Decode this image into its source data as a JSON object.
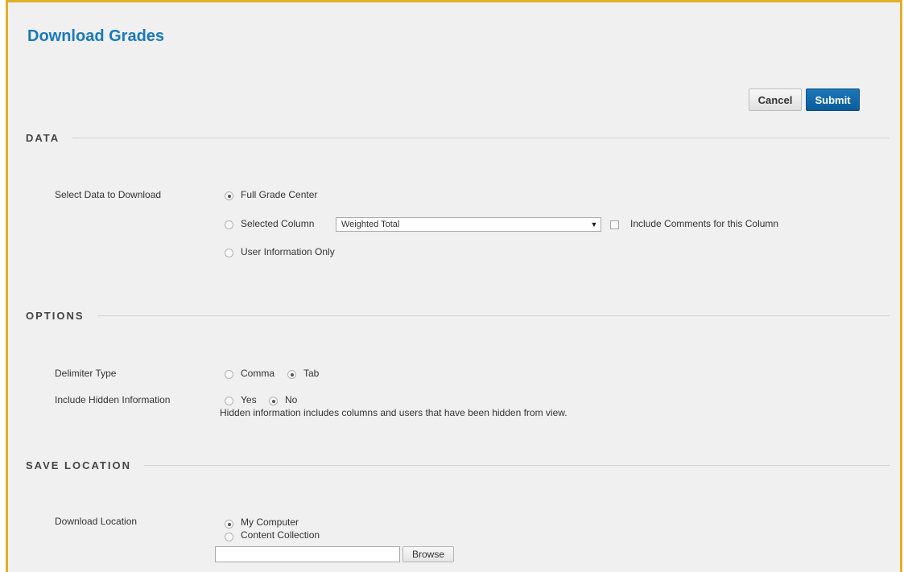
{
  "page": {
    "title": "Download Grades"
  },
  "actions": {
    "cancel_label": "Cancel",
    "submit_label": "Submit"
  },
  "sections": {
    "data": {
      "heading": "DATA",
      "select_label": "Select Data to Download",
      "opt_full": "Full Grade Center",
      "opt_selected": "Selected Column",
      "column_select_value": "Weighted Total",
      "include_comments": "Include Comments for this Column",
      "opt_user_info": "User Information Only",
      "selected": "Full Grade Center"
    },
    "options": {
      "heading": "OPTIONS",
      "delimiter_label": "Delimiter Type",
      "delim_comma": "Comma",
      "delim_tab": "Tab",
      "delimiter_selected": "Tab",
      "hidden_label": "Include Hidden Information",
      "hidden_yes": "Yes",
      "hidden_no": "No",
      "hidden_selected": "No",
      "hidden_help": "Hidden information includes columns and users that have been hidden from view."
    },
    "save": {
      "heading": "SAVE LOCATION",
      "location_label": "Download Location",
      "loc_computer": "My Computer",
      "loc_collection": "Content Collection",
      "location_selected": "My Computer",
      "path_value": "",
      "browse_label": "Browse"
    }
  },
  "colors": {
    "title": "#1a79b8",
    "frame_border": "#e0b02a",
    "submit_bg": "#0c5c99",
    "panel_bg": "#f0f0f0"
  }
}
